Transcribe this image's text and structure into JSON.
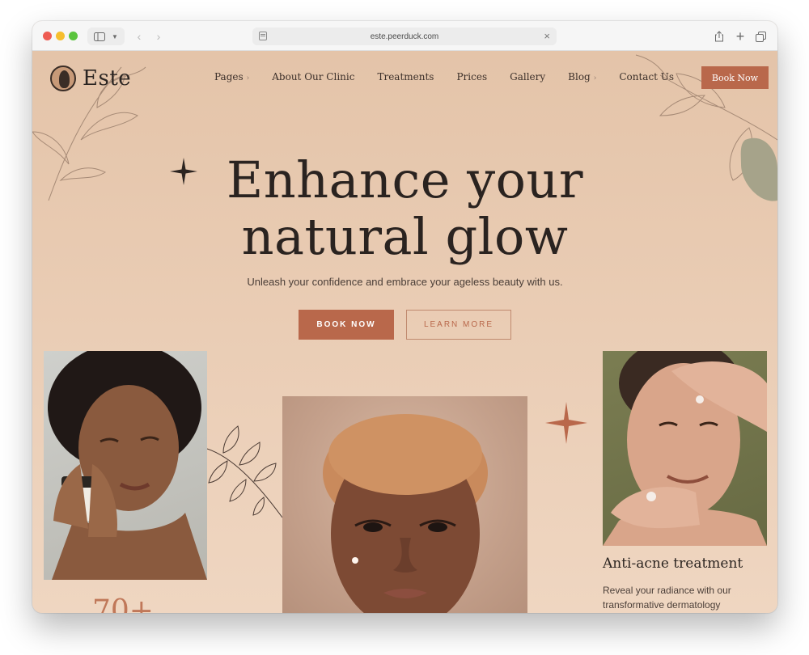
{
  "browser": {
    "url": "este.peerduck.com"
  },
  "site": {
    "logo_text": "Este",
    "nav": [
      {
        "label": "Pages",
        "has_caret": true
      },
      {
        "label": "About Our Clinic",
        "has_caret": false
      },
      {
        "label": "Treatments",
        "has_caret": false
      },
      {
        "label": "Prices",
        "has_caret": false
      },
      {
        "label": "Gallery",
        "has_caret": false
      },
      {
        "label": "Blog",
        "has_caret": true
      },
      {
        "label": "Contact Us",
        "has_caret": false
      }
    ],
    "book_button": "Book Now"
  },
  "hero": {
    "title_line1": "Enhance your",
    "title_line2": "natural glow",
    "subtitle": "Unleash your confidence and embrace your ageless beauty with us.",
    "primary_cta": "BOOK NOW",
    "secondary_cta": "LEARN MORE"
  },
  "cards": {
    "right_title": "Anti-acne treatment",
    "right_text": "Reveal your radiance with our transformative dermatology",
    "stat_partial": "70+"
  },
  "colors": {
    "accent": "#b9684b",
    "background": "#e8cdb5",
    "text_dark": "#2a2320"
  }
}
